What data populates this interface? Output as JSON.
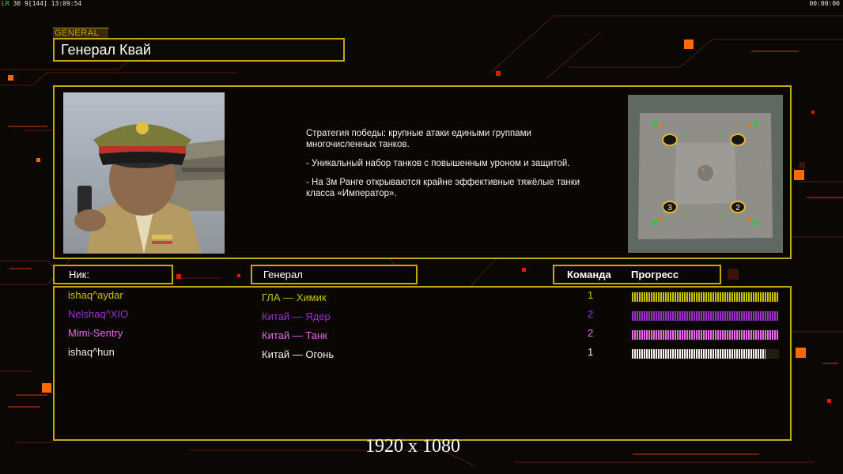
{
  "topbar": {
    "fps_label": "LR",
    "fps_value": "30",
    "stats": "9[144]",
    "clock": "13:09:54",
    "game_timer": "00:00:00"
  },
  "general": {
    "section_tag": "GENERAL",
    "name": "Генерал Квай",
    "strategy": [
      "Стратегия победы: крупные атаки едиными группами многочисленных танков.",
      "- Уникальный набор танков с повышенным уроном и защитой.",
      "- На 3м Ранге открываются крайне эффективные тяжёлые танки класса «Император»."
    ]
  },
  "headers": {
    "nick": "Ник:",
    "general": "Генерал",
    "team": "Команда",
    "progress": "Прогресс"
  },
  "players": [
    {
      "nick": "ishaq^aydar",
      "general": "ГЛА — Химик",
      "team": "1",
      "progress": 1.0,
      "color": "#c8c400"
    },
    {
      "nick": "Nelshaq^XIO",
      "general": "Китай — Ядер",
      "team": "2",
      "progress": 1.0,
      "color": "#9b2fd0"
    },
    {
      "nick": "Mimi-Sentry",
      "general": "Китай — Танк",
      "team": "2",
      "progress": 1.0,
      "color": "#e36ae8"
    },
    {
      "nick": "ishaq^hun",
      "general": "Китай — Огонь",
      "team": "1",
      "progress": 0.91,
      "color": "#f2f2f2"
    }
  ],
  "minimap": {
    "start_markers": [
      "3",
      "2"
    ]
  },
  "overlay": {
    "resolution": "1920 x 1080"
  },
  "colors": {
    "frame_gold": "#c1a80e",
    "accent_orange": "#ff7a00",
    "accent_red": "#e01a0a"
  }
}
